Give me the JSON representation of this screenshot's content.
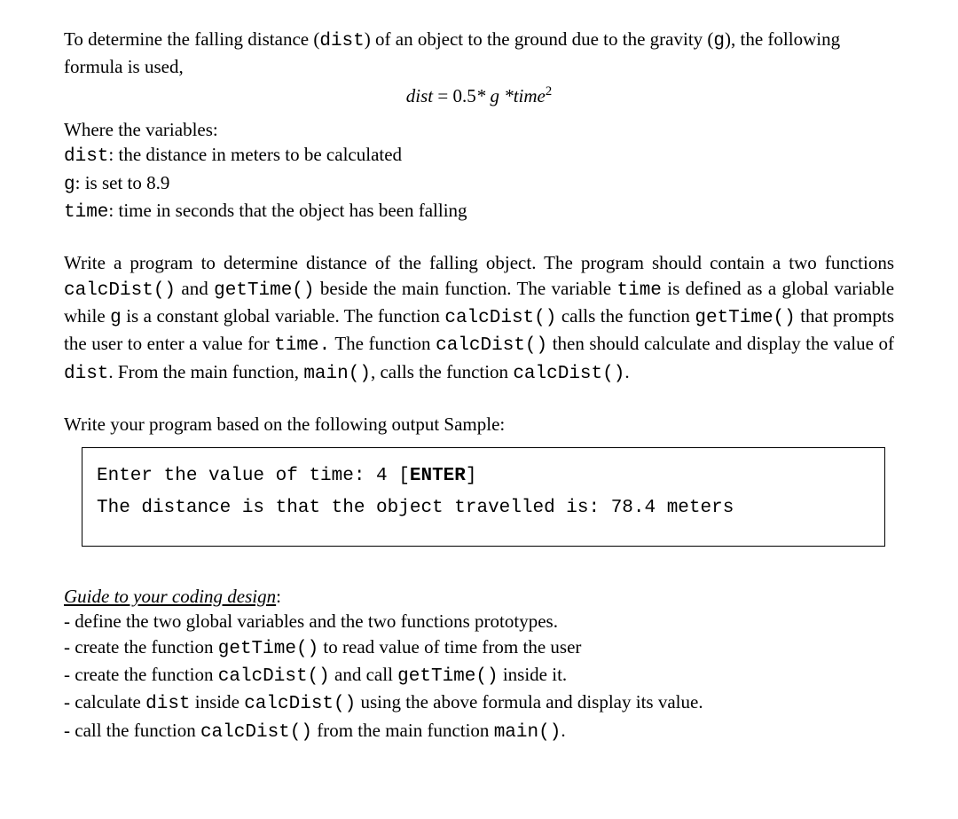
{
  "intro": {
    "part1": "To determine the falling distance (",
    "dist": "dist",
    "part2": ") of an object to the ground due to the gravity (",
    "g": "g",
    "part3": "), the following formula is used,"
  },
  "formula": {
    "lhs": "dist",
    "eq": " = ",
    "rhs1": "0.5",
    "rhs2": "* g *",
    "rhs3": "time",
    "sup": "2"
  },
  "vars": {
    "header": "Where the variables:",
    "dist_label": "dist",
    "dist_desc": ": the distance in meters to be calculated",
    "g_label": "g",
    "g_desc": ": is set to 8.9",
    "time_label": "time",
    "time_desc": ": time in seconds that the object has been falling"
  },
  "task": {
    "p1a": "Write a program to determine distance of the falling object. The program should contain a two functions ",
    "calcDist1": "calcDist()",
    "p1b": " and ",
    "getTime1": "getTime()",
    "p1c": " beside the main function. The variable ",
    "time1": "time",
    "p1d": " is defined as a global variable while ",
    "g1": "g",
    "p1e": " is a constant global variable. The function ",
    "calcDist2": "calcDist()",
    "p1f": " calls the function ",
    "getTime2": "getTime()",
    "p1g": " that prompts the user to enter a value for ",
    "time2": "time.",
    "p1h": " The function ",
    "calcDist3": "calcDist()",
    "p1i": " then should calculate and display the value of ",
    "dist1": "dist",
    "p1j": ". From the main function, ",
    "main1": "main()",
    "p1k": ", calls the function ",
    "calcDist4": "calcDist()",
    "p1l": "."
  },
  "sample_intro": "Write your program based on the following output Sample:",
  "sample": {
    "line1a": "Enter the value of time: 4 [",
    "line1b": "ENTER",
    "line1c": "]",
    "line2": "The distance is that the object travelled is: 78.4 meters"
  },
  "guide": {
    "title": "Guide to your coding design",
    "colon": ":",
    "items": [
      {
        "pre": "- define the two global variables and the two functions prototypes."
      },
      {
        "pre": "- create the function ",
        "m1": "getTime()",
        "post": " to read value of time from the user"
      },
      {
        "pre": "- create the function ",
        "m1": "calcDist()",
        "mid": " and call ",
        "m2": "getTime()",
        "post": " inside it."
      },
      {
        "pre": "- calculate ",
        "m1": "dist",
        "mid": " inside ",
        "m2": "calcDist()",
        "post": " using the above formula and display its value."
      },
      {
        "pre": "- call the function ",
        "m1": "calcDist()",
        "mid": " from the main function ",
        "m2": "main()",
        "post": "."
      }
    ]
  }
}
